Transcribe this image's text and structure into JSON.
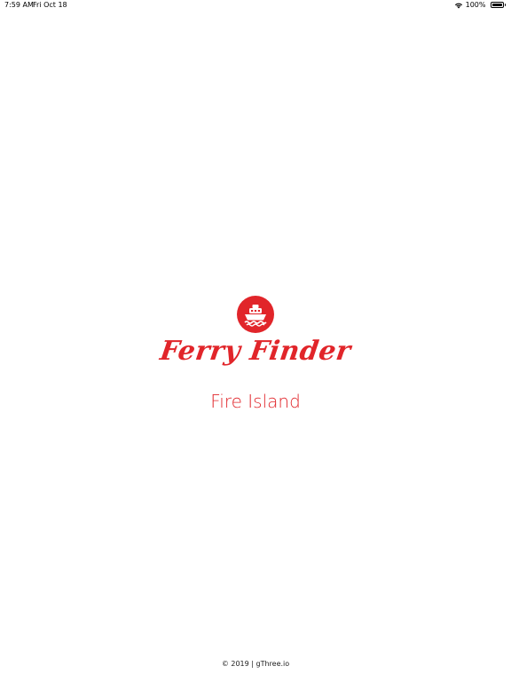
{
  "status_bar": {
    "time": "7:59 AM",
    "date": "Fri Oct 18",
    "battery_percent": "100%",
    "battery_level": 1.0,
    "wifi_icon": "wifi-icon",
    "battery_icon": "battery-icon"
  },
  "splash": {
    "logo_icon": "ship-icon",
    "title": "Ferry Finder",
    "subtitle": "Fire Island"
  },
  "footer": {
    "text": "© 2019 | gThree.io"
  },
  "colors": {
    "brand_red": "#e1252a",
    "background": "#ffffff"
  }
}
